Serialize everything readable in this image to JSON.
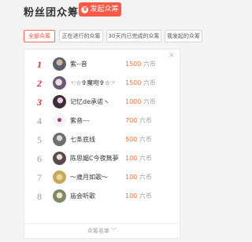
{
  "header": {
    "title": "粉丝团众筹",
    "start_button": "发起众筹",
    "start_icon": "¥"
  },
  "tabs": [
    {
      "label": "全部众筹",
      "active": true
    },
    {
      "label": "正在进行的众筹",
      "active": false
    },
    {
      "label": "30天内已完成的众筹",
      "active": false
    },
    {
      "label": "我发起的众筹",
      "active": false
    }
  ],
  "list": {
    "close_icon": "×",
    "currency": "六币",
    "rows": [
      {
        "rank": "1",
        "name": "紫--音",
        "amount": "1500"
      },
      {
        "rank": "2",
        "name": "☜☆✞魔吻✞☆☞",
        "amount": "1500"
      },
      {
        "rank": "3",
        "name": "记忆de承诺ヽ",
        "amount": "1000"
      },
      {
        "rank": "4",
        "name": "紫音---",
        "amount": "700"
      },
      {
        "rank": "5",
        "name": "七条底线",
        "amount": "500"
      },
      {
        "rank": "6",
        "name": "陈思媚C今夜無夢",
        "amount": "100"
      },
      {
        "rank": "7",
        "name": "～歲月如歌～",
        "amount": "100"
      },
      {
        "rank": "8",
        "name": "庙会听歌",
        "amount": "100"
      }
    ],
    "footer": "众筹名单 ﹀"
  },
  "colors": {
    "accent": "#ff5a48",
    "rank_top": "#e8292a",
    "amount": "#ff6a2a"
  }
}
